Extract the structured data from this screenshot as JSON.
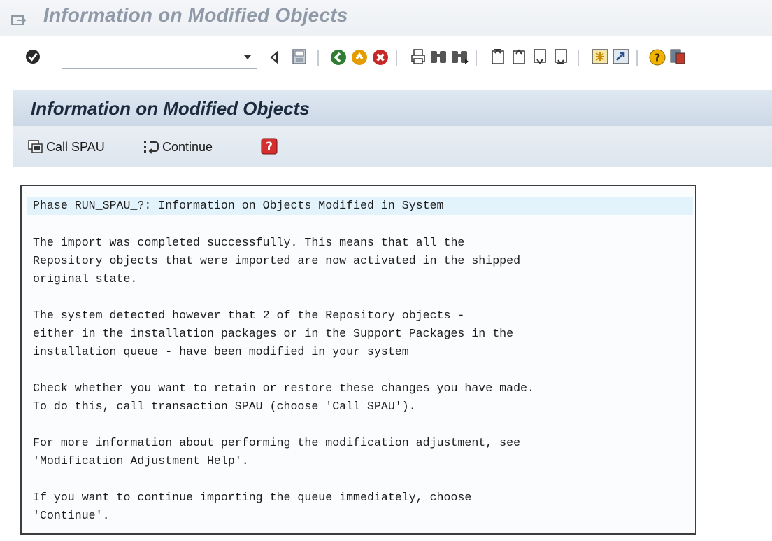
{
  "window": {
    "title": "Information on Modified Objects"
  },
  "toolbar": {
    "command_field_value": "",
    "icons": [
      "enter-icon",
      "back-arrow-icon",
      "save-icon",
      "back-icon",
      "exit-icon",
      "cancel-icon",
      "print-icon",
      "find-icon",
      "find-next-icon",
      "first-page-icon",
      "previous-page-icon",
      "next-page-icon",
      "last-page-icon",
      "create-session-icon",
      "shortcut-icon",
      "help-icon",
      "customize-layout-icon"
    ]
  },
  "app": {
    "title": "Information on Modified Objects",
    "buttons": {
      "call_spau": "Call SPAU",
      "continue": "Continue"
    }
  },
  "message": {
    "lines": [
      "Phase RUN_SPAU_?: Information on Objects Modified in System",
      "The import was completed successfully. This means that all the",
      "Repository objects that were imported are now activated in the shipped",
      "original state.",
      "The system detected however that 2 of the Repository objects -",
      "either in the installation packages or in the Support Packages in the",
      "installation queue - have been modified in your system",
      "Check whether you want to retain or restore these changes you have made.",
      "To do this, call transaction SPAU (choose 'Call SPAU').",
      "For more information about performing the modification adjustment, see",
      "'Modification Adjustment Help'.",
      "If you want to continue importing the queue immediately, choose",
      "'Continue'."
    ]
  }
}
